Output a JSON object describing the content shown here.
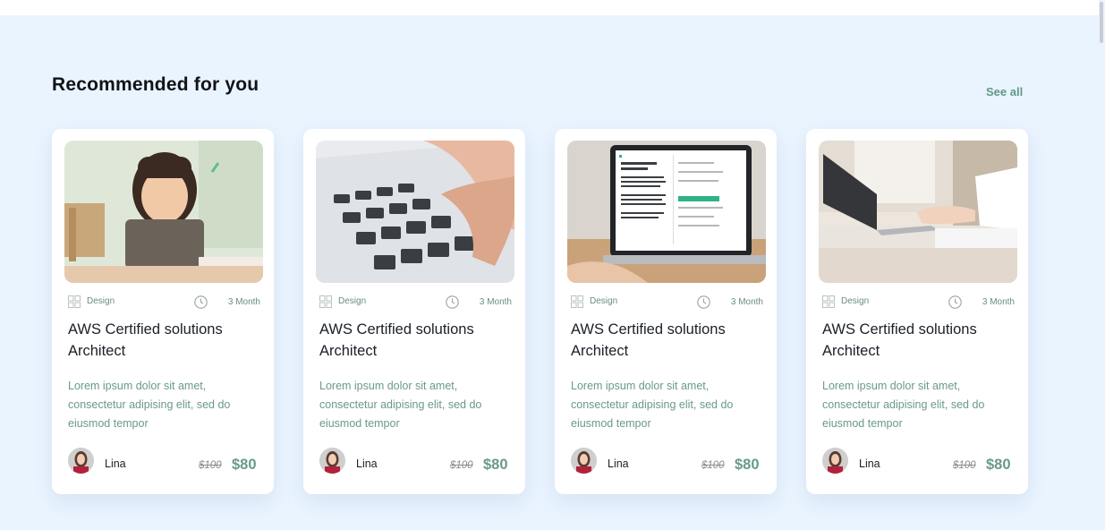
{
  "section": {
    "title": "Recommended for you",
    "see_all_label": "See all"
  },
  "colors": {
    "background": "#eaf4ff",
    "accent": "#6a9a86",
    "card": "#ffffff"
  },
  "courses": [
    {
      "image": "girl-with-tablet-photo",
      "category": "Design",
      "duration": "3 Month",
      "title": "AWS Certified solutions Architect",
      "description": "Lorem ipsum dolor sit amet, consectetur adipising elit, sed do eiusmod tempor",
      "author": "Lina",
      "old_price": "$100",
      "price": "$80"
    },
    {
      "image": "hands-typing-keyboard-photo",
      "category": "Design",
      "duration": "3 Month",
      "title": "AWS Certified solutions Architect",
      "description": "Lorem ipsum dolor sit amet, consectetur adipising elit, sed do eiusmod tempor",
      "author": "Lina",
      "old_price": "$100",
      "price": "$80"
    },
    {
      "image": "laptop-screen-app-photo",
      "category": "Design",
      "duration": "3 Month",
      "title": "AWS Certified solutions Architect",
      "description": "Lorem ipsum dolor sit amet, consectetur adipising elit, sed do eiusmod tempor",
      "author": "Lina",
      "old_price": "$100",
      "price": "$80"
    },
    {
      "image": "laptop-on-desk-photo",
      "category": "Design",
      "duration": "3 Month",
      "title": "AWS Certified solutions Architect",
      "description": "Lorem ipsum dolor sit amet, consectetur adipising elit, sed do eiusmod tempor",
      "author": "Lina",
      "old_price": "$100",
      "price": "$80"
    }
  ]
}
